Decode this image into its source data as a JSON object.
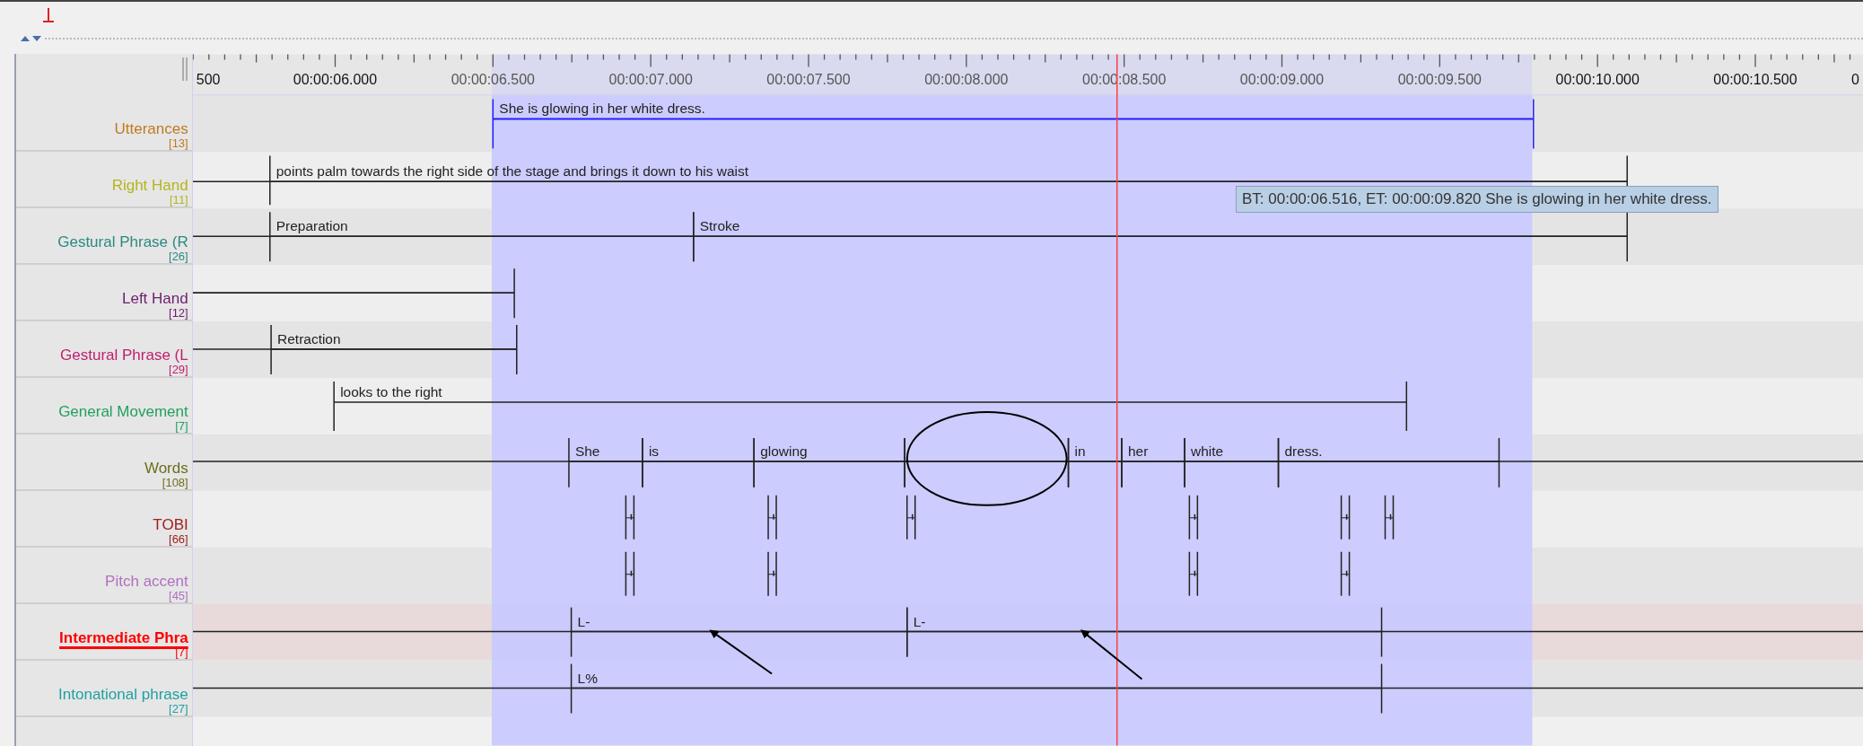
{
  "ruler": {
    "labels": [
      "500",
      "00:00:06.000",
      "00:00:06.500",
      "00:00:07.000",
      "00:00:07.500",
      "00:00:08.000",
      "00:00:08.500",
      "00:00:09.000",
      "00:00:09.500",
      "00:00:10.000",
      "00:00:10.500",
      "0"
    ]
  },
  "tiers": [
    {
      "name": "Utterances",
      "count": "[13]",
      "color": "#c07a20",
      "selected": false,
      "annotations": [
        {
          "kind": "segment",
          "text": "She is glowing in her white dress.",
          "selected": true
        }
      ]
    },
    {
      "name": "Right Hand",
      "count": "[11]",
      "color": "#b5b51e",
      "selected": false,
      "annotations": [
        {
          "kind": "segment",
          "text": "points palm towards the right side of the stage and brings it down to his waist",
          "selected": false
        }
      ]
    },
    {
      "name": "Gestural Phrase (R",
      "count": "[26]",
      "color": "#2a8a80",
      "selected": false,
      "annotations": [
        {
          "kind": "segment",
          "text": "Preparation",
          "selected": false
        },
        {
          "kind": "segment",
          "text": "Stroke",
          "selected": false
        }
      ]
    },
    {
      "name": "Left Hand",
      "count": "[12]",
      "color": "#6e1e6e",
      "selected": false,
      "annotations": [
        {
          "kind": "segment",
          "selected": false
        }
      ]
    },
    {
      "name": "Gestural Phrase (L",
      "count": "[29]",
      "color": "#c01e6e",
      "selected": false,
      "annotations": [
        {
          "kind": "segment",
          "text": "Retraction",
          "selected": false
        }
      ]
    },
    {
      "name": "General Movement",
      "count": "[7]",
      "color": "#22a060",
      "selected": false,
      "annotations": [
        {
          "kind": "segment",
          "text": "looks to the right",
          "selected": false
        }
      ]
    },
    {
      "name": "Words",
      "count": "[108]",
      "color": "#6e6e1e",
      "selected": false,
      "annotations": [
        {
          "kind": "segment",
          "text": "She",
          "selected": false
        },
        {
          "kind": "segment",
          "text": "is",
          "selected": false
        },
        {
          "kind": "segment",
          "text": "glowing",
          "selected": false
        },
        {
          "kind": "segment",
          "selected": false
        },
        {
          "kind": "segment",
          "text": "in",
          "selected": false
        },
        {
          "kind": "segment",
          "text": "her",
          "selected": false
        },
        {
          "kind": "segment",
          "text": "white",
          "selected": false
        },
        {
          "kind": "segment",
          "text": "dress.",
          "selected": false
        }
      ]
    },
    {
      "name": "TOBI",
      "count": "[66]",
      "color": "#a01e1e",
      "selected": false,
      "annotations": [
        {
          "kind": "point"
        },
        {
          "kind": "point"
        },
        {
          "kind": "point"
        },
        {
          "kind": "point"
        },
        {
          "kind": "point"
        },
        {
          "kind": "point"
        }
      ]
    },
    {
      "name": "Pitch accent",
      "count": "[45]",
      "color": "#b070c0",
      "selected": false,
      "annotations": [
        {
          "kind": "point"
        },
        {
          "kind": "point"
        },
        {
          "kind": "point"
        },
        {
          "kind": "point"
        }
      ]
    },
    {
      "name": "Intermediate Phra",
      "count": "[7]",
      "color": "#ff0000",
      "selected": true,
      "annotations": [
        {
          "kind": "segment",
          "text": "L-",
          "selected": false
        },
        {
          "kind": "segment",
          "text": "L-",
          "selected": false
        }
      ]
    },
    {
      "name": "Intonational phrase",
      "count": "[27]",
      "color": "#20a0a0",
      "selected": false,
      "annotations": [
        {
          "kind": "segment",
          "text": "L%",
          "selected": false
        }
      ]
    }
  ],
  "tooltip": "BT: 00:00:06.516, ET: 00:00:09.820 She is glowing in her white dress."
}
